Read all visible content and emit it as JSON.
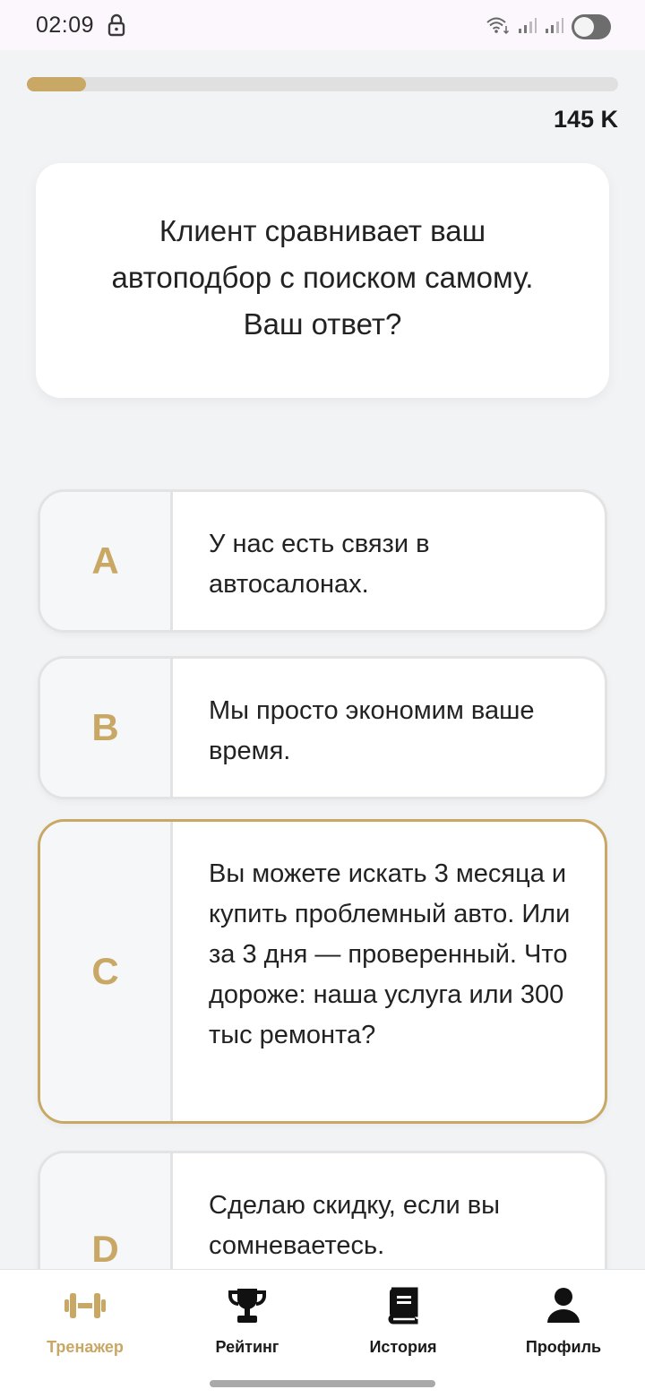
{
  "status_bar": {
    "time": "02:09"
  },
  "progress": {
    "fraction": 0.1,
    "score": "145 K"
  },
  "question": {
    "text": "Клиент сравнивает ваш автоподбор с поиском самому. Ваш ответ?"
  },
  "answers": [
    {
      "letter": "A",
      "text": "У нас есть связи в автосалонах.",
      "selected": false
    },
    {
      "letter": "B",
      "text": "Мы просто экономим ваше время.",
      "selected": false
    },
    {
      "letter": "C",
      "text": "Вы можете искать 3 месяца и купить проблемный авто. Или за 3 дня — проверенный. Что дороже: наша услуга или 300 тыс ремонта?",
      "selected": true
    },
    {
      "letter": "D",
      "text": "Сделаю скидку, если вы сомневаетесь.",
      "selected": false
    }
  ],
  "nav": {
    "items": [
      {
        "label": "Тренажер",
        "icon": "dumbbell-icon",
        "active": true
      },
      {
        "label": "Рейтинг",
        "icon": "trophy-icon",
        "active": false
      },
      {
        "label": "История",
        "icon": "book-icon",
        "active": false
      },
      {
        "label": "Профиль",
        "icon": "person-icon",
        "active": false
      }
    ]
  },
  "colors": {
    "accent": "#c9a764",
    "background": "#f2f3f5"
  }
}
